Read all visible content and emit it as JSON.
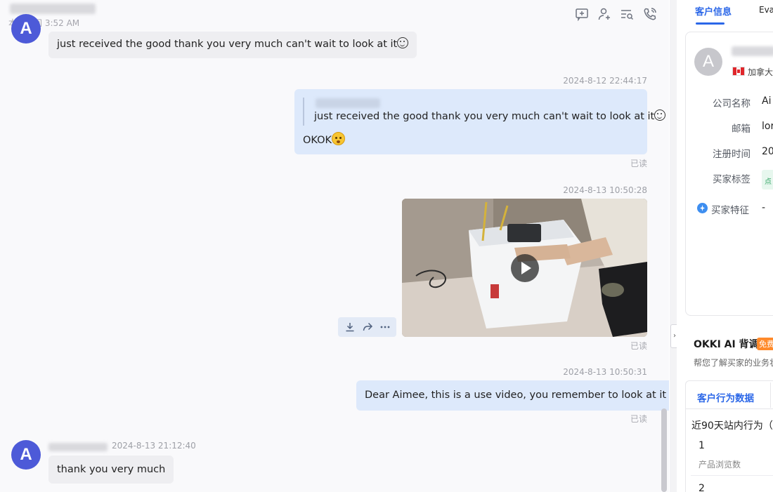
{
  "header": {
    "local_time": "本地时间 3:52 AM",
    "icons": [
      "add-chat-icon",
      "user-add-icon",
      "search-list-icon",
      "phone-icon"
    ]
  },
  "messages": [
    {
      "id": "m1",
      "direction": "in",
      "text": "just received the good thank you very much can't wait to look at it"
    },
    {
      "id": "m2",
      "direction": "out",
      "timestamp": "2024-8-12 22:44:17",
      "quoted_text": "just received the good thank you very much can't wait to look at it",
      "text": "OKOK",
      "status": "已读"
    },
    {
      "id": "m3",
      "direction": "out",
      "timestamp": "2024-8-13 10:50:28",
      "type": "video",
      "status": "已读"
    },
    {
      "id": "m4",
      "direction": "out",
      "timestamp": "2024-8-13 10:50:31",
      "text": "Dear Aimee, this is a use video, you remember to look at it",
      "status": "已读"
    },
    {
      "id": "m5",
      "direction": "in",
      "timestamp": "2024-8-13 21:12:40",
      "avatar_letter": "A",
      "text": "thank you very much"
    }
  ],
  "right_panel": {
    "tabs": [
      "客户信息",
      "Eva"
    ],
    "customer": {
      "avatar_letter": "A",
      "country": "加拿大",
      "fields": [
        {
          "label": "公司名称",
          "value": "Ai"
        },
        {
          "label": "邮箱",
          "value": "lor"
        },
        {
          "label": "注册时间",
          "value": "20"
        },
        {
          "label": "买家标签",
          "value": ""
        },
        {
          "label": "买家特征",
          "value": "-"
        }
      ],
      "tag_chip": "点"
    },
    "ai_section": {
      "title": "OKKI AI 背调",
      "badge": "免费",
      "subtitle": "帮您了解买家的业务状"
    },
    "behavior": {
      "tab": "客户行为数据",
      "title": "近90天站内行为（",
      "stats": [
        {
          "value": "1",
          "label": "产品浏览数"
        },
        {
          "value": "2",
          "label": ""
        }
      ]
    }
  },
  "colors": {
    "accent": "#2b67e8",
    "avatar": "#4d5ad8",
    "out_bubble": "#dde9fb",
    "in_bubble": "#eeeef1"
  }
}
